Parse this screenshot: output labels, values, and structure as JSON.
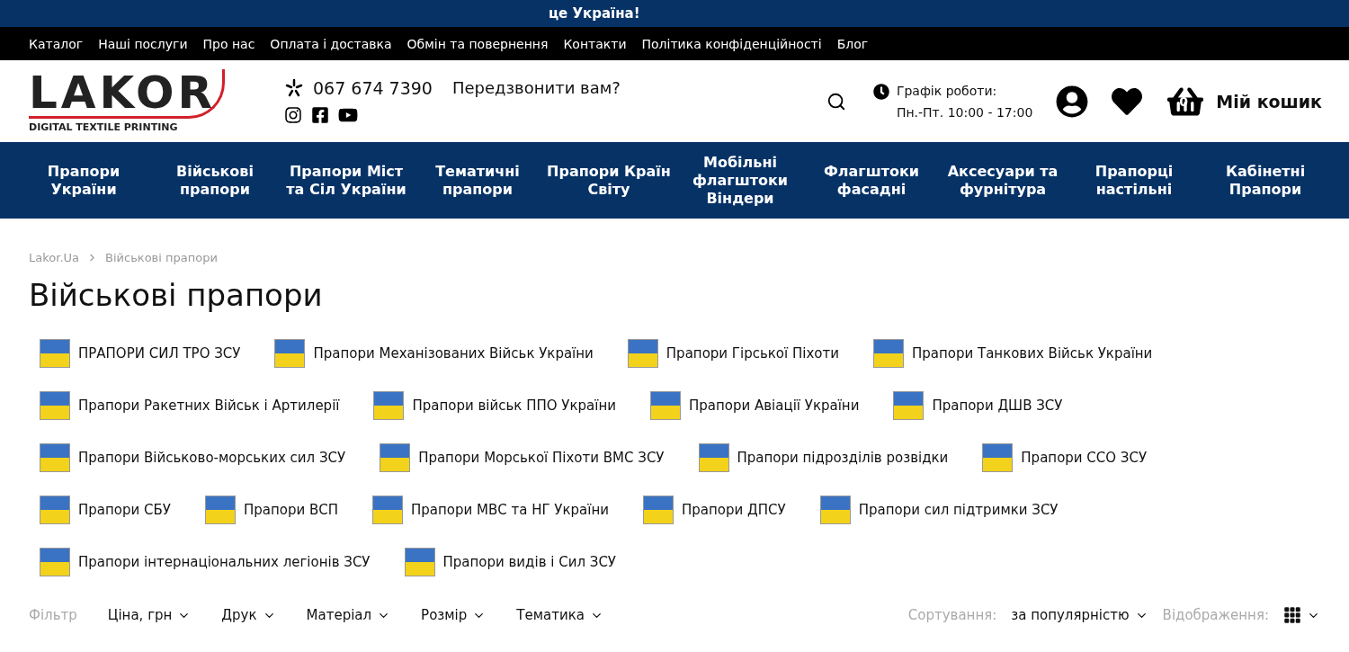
{
  "banner": {
    "text": "це Україна!"
  },
  "top_menu": [
    "Каталог",
    "Наші послуги",
    "Про нас",
    "Оплата і доставка",
    "Обмін та повернення",
    "Контакти",
    "Політика конфіденційності",
    "Блог"
  ],
  "header": {
    "logo_text": "LAKOR",
    "logo_tagline": "DIGITAL TEXTILE PRINTING",
    "phone": "067 674 7390",
    "callback": "Передзвонити вам?",
    "schedule_label": "Графік роботи:",
    "schedule_hours": "Пн.-Пт. 10:00 - 17:00",
    "cart_count": "0",
    "cart_label": "Мій кошик"
  },
  "main_nav": [
    "Прапори України",
    "Військові прапори",
    "Прапори Міст та Сіл України",
    "Тематичні прапори",
    "Прапори Країн Світу",
    "Мобільні флагштоки Віндери",
    "Флагштоки фасадні",
    "Аксесуари та фурнітура",
    "Прапорці настільні",
    "Кабінетні Прапори"
  ],
  "breadcrumbs": [
    "Lakor.Ua",
    "Військові прапори"
  ],
  "page_title": "Військові прапори",
  "category_rows": [
    [
      "ПРАПОРИ СИЛ ТРО ЗСУ",
      "Прапори Механізованих Військ України",
      "Прапори Гірської Піхоти",
      "Прапори Танкових Військ України"
    ],
    [
      "Прапори Ракетних Військ і Артилерії",
      "Прапори військ ППО України",
      "Прапори Авіації України",
      "Прапори ДШВ ЗСУ"
    ],
    [
      "Прапори Військово-морських сил ЗСУ",
      "Прапори Морської Піхоти ВМС ЗСУ",
      "Прапори підрозділів розвідки",
      "Прапори ССО ЗСУ"
    ],
    [
      "Прапори СБУ",
      "Прапори ВСП",
      "Прапори МВС та НГ України",
      "Прапори ДПСУ",
      "Прапори сил підтримки ЗСУ"
    ],
    [
      "Прапори інтернаціональних легіонів ЗСУ",
      "Прапори видів і Сил ЗСУ"
    ]
  ],
  "filters": {
    "label": "Фільтр",
    "items": [
      "Ціна, грн",
      "Друк",
      "Матеріал",
      "Розмір",
      "Тематика"
    ],
    "sort_label": "Сортування:",
    "sort_value": "за популярністю",
    "view_label": "Відображення:"
  }
}
